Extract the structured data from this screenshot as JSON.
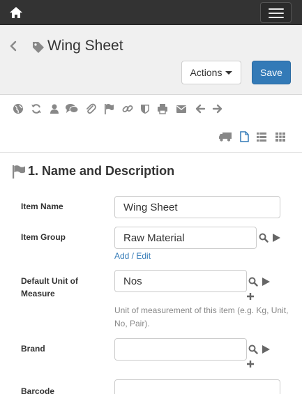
{
  "header": {
    "title": "Wing Sheet"
  },
  "buttons": {
    "actions": "Actions",
    "save": "Save"
  },
  "section": {
    "title": "1. Name and Description"
  },
  "fields": {
    "item_name": {
      "label": "Item Name",
      "value": "Wing Sheet"
    },
    "item_group": {
      "label": "Item Group",
      "value": "Raw Material",
      "link": "Add / Edit"
    },
    "uom": {
      "label_line1": "Default Unit of",
      "label_line2": "Measure",
      "value": "Nos",
      "help": "Unit of measurement of this item (e.g. Kg, Unit, No, Pair)."
    },
    "brand": {
      "label": "Brand",
      "value": ""
    },
    "barcode": {
      "label": "Barcode",
      "value": ""
    }
  },
  "colors": {
    "navbar": "#333333",
    "primary": "#337ab7",
    "header_bg": "#f0f0f0",
    "icon": "#888888"
  }
}
